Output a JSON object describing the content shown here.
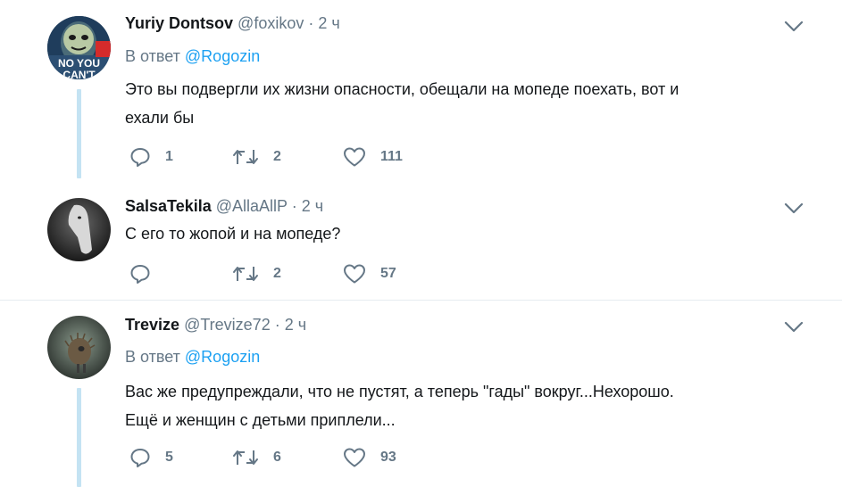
{
  "tweets": [
    {
      "name": "Yuriy Dontsov",
      "handle": "@foxikov",
      "dot": "·",
      "time": "2 ч",
      "reply_prefix": "В ответ",
      "reply_to": "@Rogozin",
      "text_lines": [
        "Это вы подвергли их жизни опасности, обещали на мопеде поехать, вот и",
        "ехали бы"
      ],
      "replies": "1",
      "retweets": "2",
      "likes": "111",
      "avatar_caption": "NO YOU CAN'T"
    },
    {
      "name": "SalsaTekila",
      "handle": "@AllaAllP",
      "dot": "·",
      "time": "2 ч",
      "text_lines": [
        "С его то жопой и на мопеде?"
      ],
      "replies": "",
      "retweets": "2",
      "likes": "57"
    },
    {
      "name": "Trevize",
      "handle": "@Trevize72",
      "dot": "·",
      "time": "2 ч",
      "reply_prefix": "В ответ",
      "reply_to": "@Rogozin",
      "text_lines": [
        "Вас же предупреждали, что не пустят, а теперь \"гады\" вокруг...Нехорошо.",
        "Ещё и женщин с детьми приплели..."
      ],
      "replies": "5",
      "retweets": "6",
      "likes": "93"
    }
  ],
  "colors": {
    "link": "#1da1f2",
    "secondary": "#657786",
    "thread_line": "#c4e3f3",
    "divider": "#e6ecf0"
  },
  "icons": {
    "reply": "reply-icon",
    "retweet": "retweet-icon",
    "like": "like-icon",
    "menu": "chevron-down-icon"
  }
}
